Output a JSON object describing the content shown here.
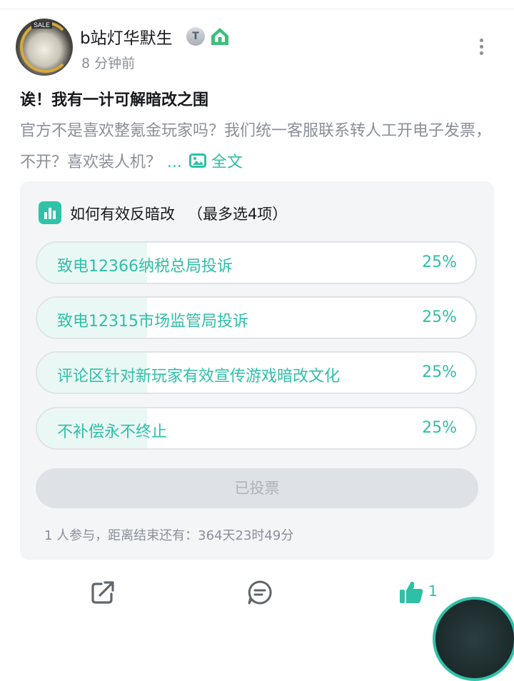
{
  "user": {
    "name": "b站灯华默生",
    "level_badge": "T",
    "time": "8 分钟前",
    "avatar_text": "SALE"
  },
  "post": {
    "title": "诶！我有一计可解暗改之围",
    "body": "官方不是喜欢整氪金玩家吗？我们统一客服联系转人工开电子发票，不开？喜欢装人机？",
    "ellipsis": "...",
    "fulltext_label": "全文"
  },
  "poll": {
    "title": "如何有效反暗改",
    "limit_note": "（最多选4项）",
    "options": [
      {
        "label": "致电12366纳税总局投诉",
        "percent_text": "25%",
        "share": 0.25
      },
      {
        "label": "致电12315市场监管局投诉",
        "percent_text": "25%",
        "share": 0.25
      },
      {
        "label": "评论区针对新玩家有效宣传游戏暗改文化",
        "percent_text": "25%",
        "share": 0.25
      },
      {
        "label": "不补偿永不终止",
        "percent_text": "25%",
        "share": 0.25
      }
    ],
    "voted_label": "已投票",
    "footer": "1 人参与，距离结束还有：364天23时49分"
  },
  "actions": {
    "like_count": "1"
  },
  "colors": {
    "accent": "#2fbfa7",
    "poll_bg": "#f4f5f7",
    "option_fill": "#eaf8f5",
    "muted_text": "#8a8f98"
  },
  "icons": [
    "more-icon",
    "image-icon",
    "poll-chart-icon",
    "share-icon",
    "comment-icon",
    "thumbs-up-icon",
    "home-badge-icon"
  ]
}
